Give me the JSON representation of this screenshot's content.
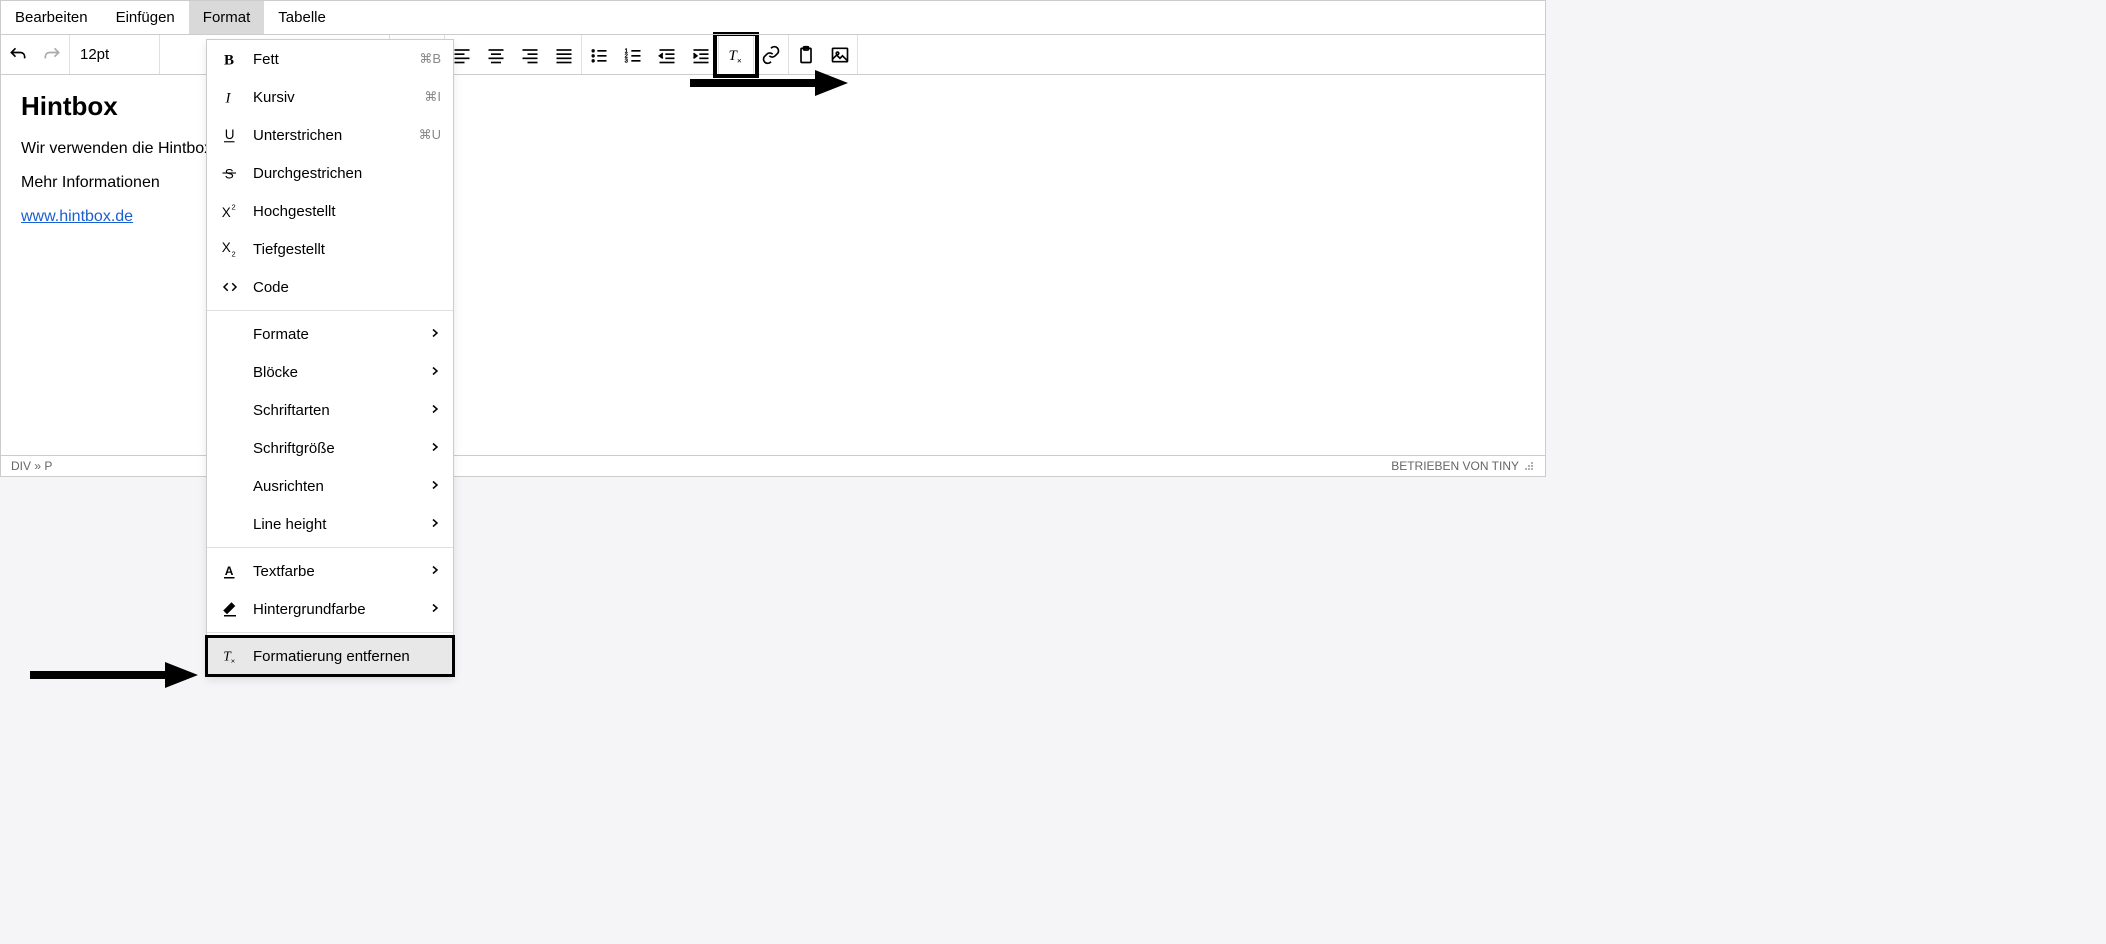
{
  "menubar": [
    {
      "label": "Bearbeiten",
      "active": false
    },
    {
      "label": "Einfügen",
      "active": false
    },
    {
      "label": "Format",
      "active": true
    },
    {
      "label": "Tabelle",
      "active": false
    }
  ],
  "toolbar": {
    "fontsize": "12pt"
  },
  "dropdown": {
    "group1": [
      {
        "icon": "bold",
        "label": "Fett",
        "shortcut": "⌘B"
      },
      {
        "icon": "italic",
        "label": "Kursiv",
        "shortcut": "⌘I"
      },
      {
        "icon": "underline",
        "label": "Unterstrichen",
        "shortcut": "⌘U"
      },
      {
        "icon": "strike",
        "label": "Durchgestrichen",
        "shortcut": ""
      },
      {
        "icon": "super",
        "label": "Hochgestellt",
        "shortcut": ""
      },
      {
        "icon": "sub",
        "label": "Tiefgestellt",
        "shortcut": ""
      },
      {
        "icon": "code",
        "label": "Code",
        "shortcut": ""
      }
    ],
    "group2": [
      {
        "label": "Formate"
      },
      {
        "label": "Blöcke"
      },
      {
        "label": "Schriftarten"
      },
      {
        "label": "Schriftgröße"
      },
      {
        "label": "Ausrichten"
      },
      {
        "label": "Line height"
      }
    ],
    "group3": [
      {
        "icon": "textcolor",
        "label": "Textfarbe"
      },
      {
        "icon": "bgcolor",
        "label": "Hintergrundfarbe"
      }
    ],
    "group4": [
      {
        "icon": "clearfmt",
        "label": "Formatierung entfernen"
      }
    ]
  },
  "content": {
    "heading": "Hintbox",
    "p1": "Wir verwenden die Hintbox als Hinweisgebersystem.",
    "p2": "Mehr Informationen",
    "link": "www.hintbox.de"
  },
  "statusbar": {
    "path": "DIV » P",
    "branding": "BETRIEBEN VON TINY"
  }
}
